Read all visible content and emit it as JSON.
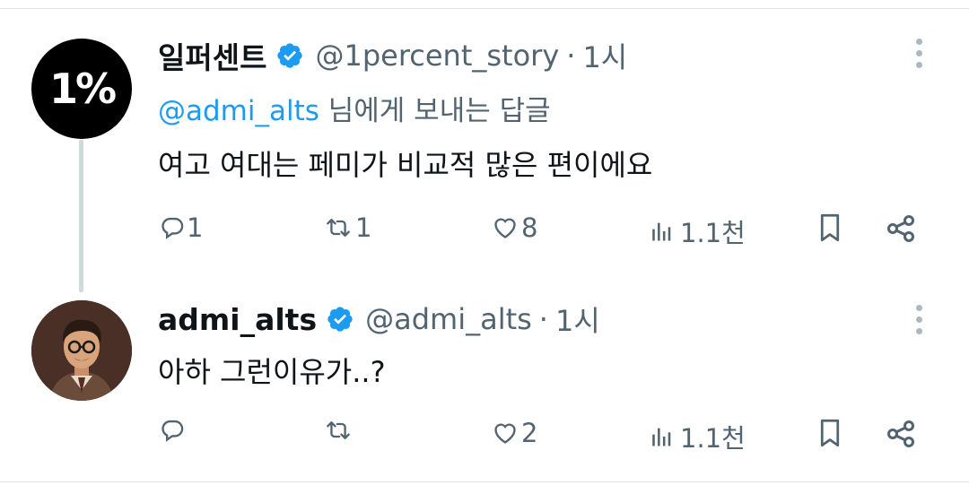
{
  "tweets": [
    {
      "avatar_text": "1%",
      "name": "일퍼센트",
      "handle": "@1percent_story",
      "separator": "·",
      "time": "1시",
      "reply_to": {
        "mention": "@admi_alts",
        "suffix": " 님에게 보내는 답글"
      },
      "text": "여고 여대는 페미가 비교적 많은 편이에요",
      "actions": {
        "replies": "1",
        "retweets": "1",
        "likes": "8",
        "views": "1.1천"
      }
    },
    {
      "name": "admi_alts",
      "handle": "@admi_alts",
      "separator": "·",
      "time": "1시",
      "text": "아하 그런이유가..?",
      "actions": {
        "replies": "",
        "retweets": "",
        "likes": "2",
        "views": "1.1천"
      }
    }
  ],
  "icons": [
    "verified-badge-icon",
    "more-icon",
    "reply-icon",
    "retweet-icon",
    "like-icon",
    "views-icon",
    "bookmark-icon",
    "share-icon"
  ],
  "colors": {
    "verified": "#1d9bf0",
    "mention": "#1d9bf0",
    "secondary_text": "#536471",
    "thread_line": "#cfd9de"
  }
}
